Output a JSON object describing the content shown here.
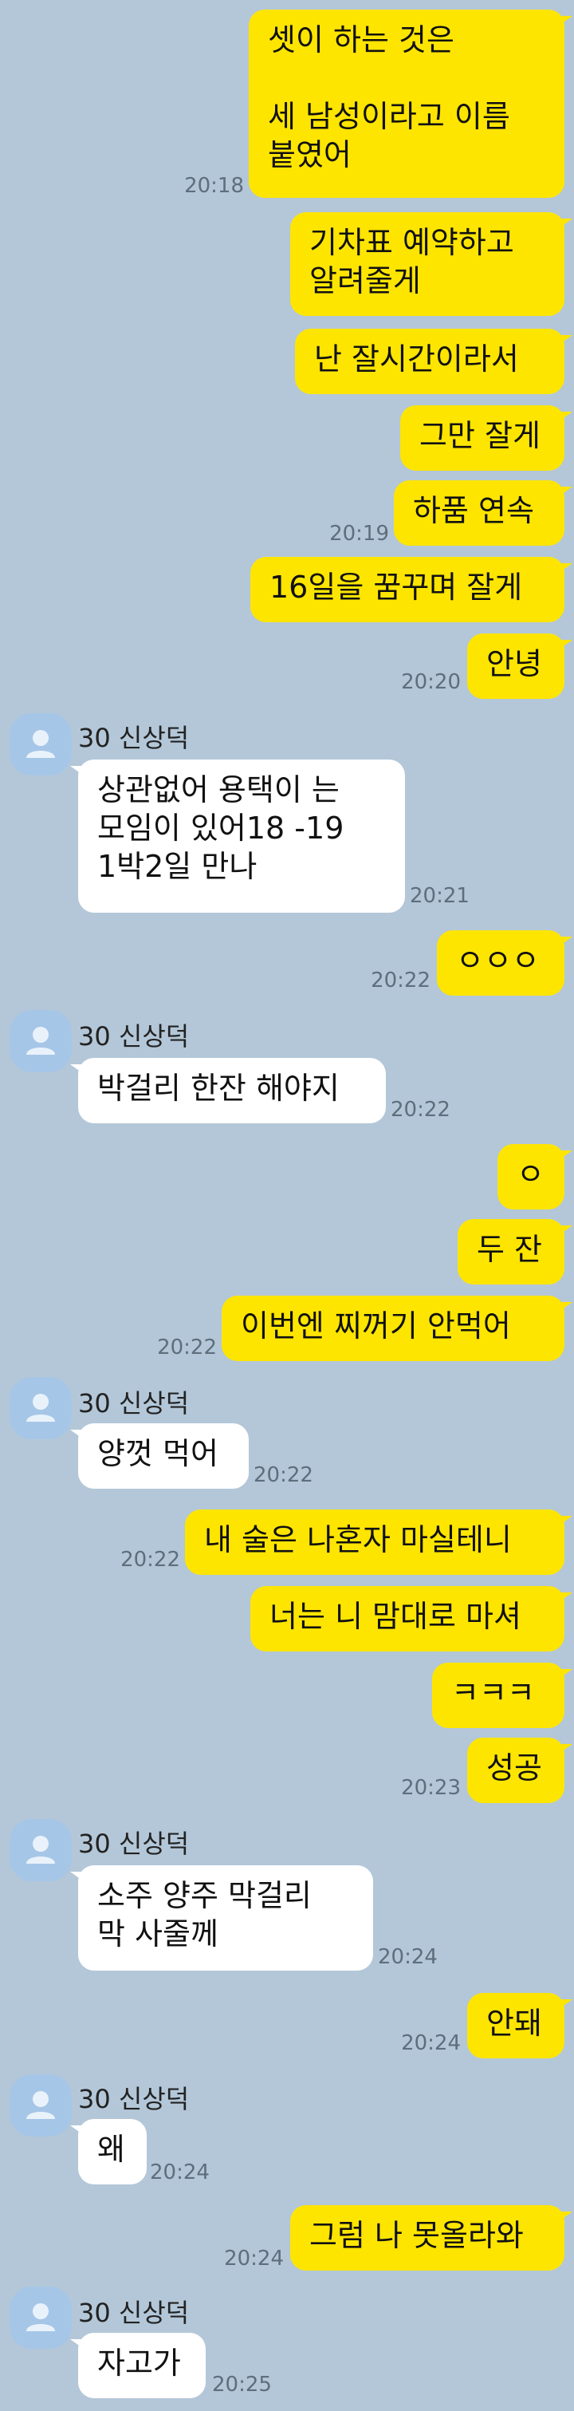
{
  "colors": {
    "background": "#b3c7d8",
    "my_bubble": "#fee500",
    "their_bubble": "#ffffff",
    "avatar": "#a6c6e7",
    "timestamp": "#5e6e7d"
  },
  "contact": {
    "name": "30 신상덕",
    "avatar_icon": "default-profile-icon"
  },
  "messages": [
    {
      "from": "me",
      "text": "셋이 하는 것은\n\n세 남성이라고 이름\n붙였어",
      "time": "20:18"
    },
    {
      "from": "me",
      "text": "기차표 예약하고\n알려줄게",
      "time": ""
    },
    {
      "from": "me",
      "text": "난 잘시간이라서",
      "time": ""
    },
    {
      "from": "me",
      "text": "그만 잘게",
      "time": ""
    },
    {
      "from": "me",
      "text": "하품 연속",
      "time": "20:19"
    },
    {
      "from": "me",
      "text": "16일을 꿈꾸며 잘게",
      "time": ""
    },
    {
      "from": "me",
      "text": "안녕",
      "time": "20:20"
    },
    {
      "from": "contact",
      "text": "상관없어  용택이 는\n모임이 있어18 -19\n1박2일 만나",
      "time": "20:21"
    },
    {
      "from": "me",
      "text": "ㅇㅇㅇ",
      "time": "20:22"
    },
    {
      "from": "contact",
      "text": "박걸리 한잔 해야지",
      "time": "20:22"
    },
    {
      "from": "me",
      "text": "ㅇ",
      "time": ""
    },
    {
      "from": "me",
      "text": "두 잔",
      "time": ""
    },
    {
      "from": "me",
      "text": "이번엔 찌꺼기 안먹어",
      "time": "20:22"
    },
    {
      "from": "contact",
      "text": "양껏 먹어",
      "time": "20:22"
    },
    {
      "from": "me",
      "text": "내 술은 나혼자 마실테니",
      "time": "20:22"
    },
    {
      "from": "me",
      "text": "너는 니 맘대로 마셔",
      "time": ""
    },
    {
      "from": "me",
      "text": "ㅋㅋㅋ",
      "time": ""
    },
    {
      "from": "me",
      "text": "성공",
      "time": "20:23"
    },
    {
      "from": "contact",
      "text": "소주 양주 막걸리\n막 사줄께",
      "time": "20:24"
    },
    {
      "from": "me",
      "text": "안돼",
      "time": "20:24"
    },
    {
      "from": "contact",
      "text": "왜",
      "time": "20:24"
    },
    {
      "from": "me",
      "text": "그럼 나 못올라와",
      "time": "20:24"
    },
    {
      "from": "contact",
      "text": "자고가",
      "time": "20:25"
    }
  ]
}
